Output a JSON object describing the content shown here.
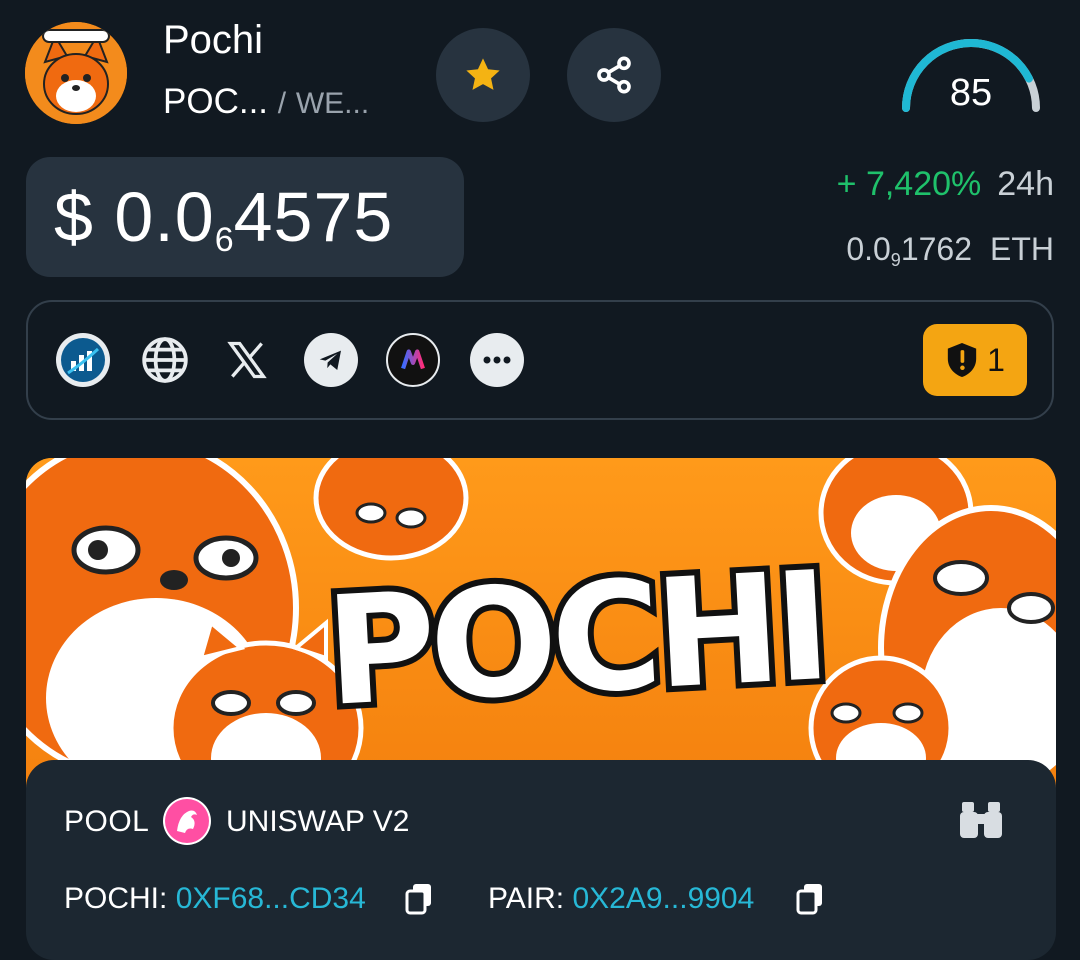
{
  "token": {
    "name": "Pochi",
    "symbol": "POC...",
    "pair_separator": "/",
    "pair_symbol": "WE..."
  },
  "score": {
    "value": "85",
    "fraction": 0.85,
    "color": "#1fb8d4"
  },
  "price": {
    "currency": "$",
    "prefix": "0.0",
    "zero_count": "6",
    "digits": "4575"
  },
  "change": {
    "percent": "+ 7,420%",
    "period": "24h",
    "color": "#1fc16b"
  },
  "price_eth": {
    "prefix": "0.0",
    "zero_count": "9",
    "digits": "1762",
    "unit": "ETH"
  },
  "links": [
    {
      "name": "dextools-icon"
    },
    {
      "name": "globe-icon"
    },
    {
      "name": "x-icon"
    },
    {
      "name": "telegram-icon"
    },
    {
      "name": "app-icon"
    },
    {
      "name": "more-icon"
    }
  ],
  "security": {
    "count": "1",
    "color": "#f4a512"
  },
  "banner": {
    "text": "POCHI"
  },
  "pool": {
    "label": "POOL",
    "dex": "UNISWAP V2",
    "token_label": "POCHI:",
    "token_address": "0XF68...CD34",
    "pair_label": "PAIR:",
    "pair_address": "0X2A9...9904"
  }
}
